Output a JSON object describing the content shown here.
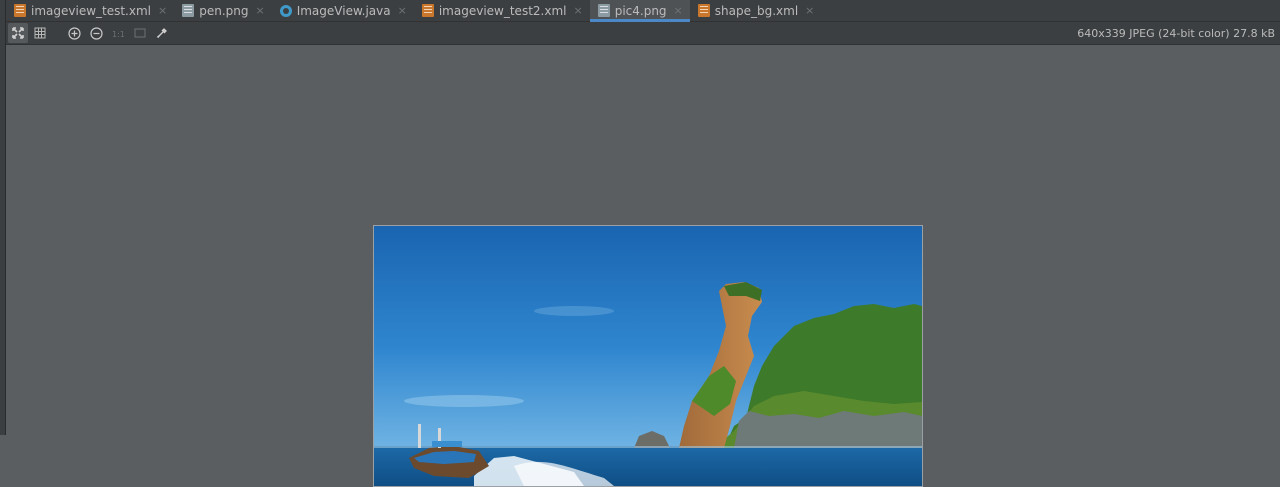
{
  "tabs": [
    {
      "label": "imageview_test.xml",
      "type": "xml",
      "active": false
    },
    {
      "label": "pen.png",
      "type": "img",
      "active": false
    },
    {
      "label": "ImageView.java",
      "type": "java",
      "active": false
    },
    {
      "label": "imageview_test2.xml",
      "type": "xml",
      "active": false
    },
    {
      "label": "pic4.png",
      "type": "img",
      "active": true
    },
    {
      "label": "shape_bg.xml",
      "type": "xml",
      "active": false
    }
  ],
  "tab_close_glyph": "×",
  "toolbar": {
    "icons": [
      "fit-to-window-icon",
      "grid-icon",
      "zoom-in-icon",
      "zoom-out-icon",
      "actual-size-icon",
      "background-icon",
      "eyedropper-icon"
    ]
  },
  "image_info": "640x339 JPEG (24-bit color) 27.8 kB",
  "colors": {
    "accent": "#4a88c7",
    "sky": "#1f6fb8",
    "sea": "#1b5f9a"
  }
}
